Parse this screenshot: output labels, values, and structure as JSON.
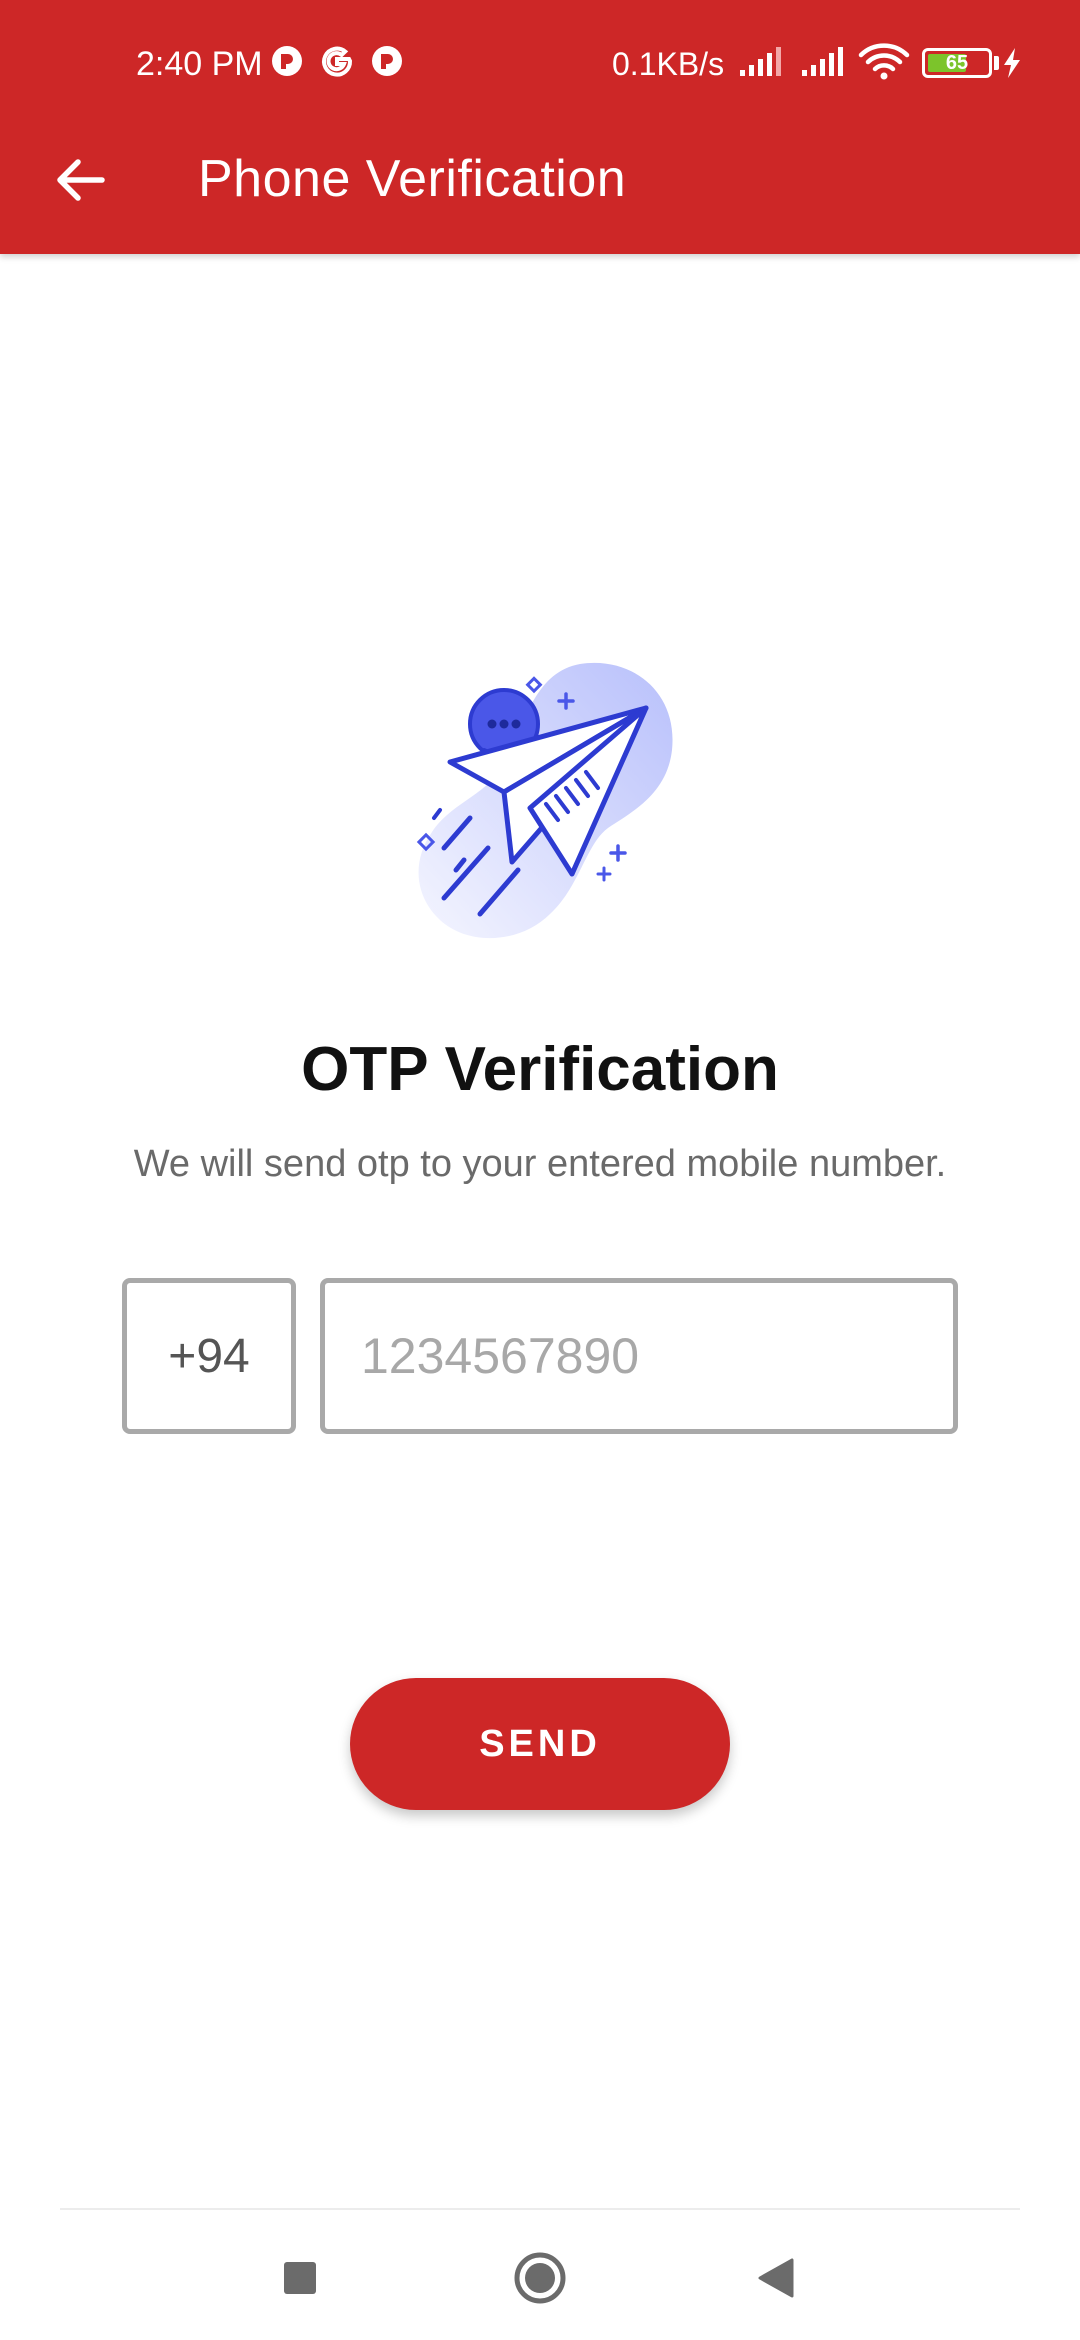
{
  "status_bar": {
    "time": "2:40 PM",
    "net_speed": "0.1KB/s",
    "battery_level": "65",
    "battery_fraction": 0.65,
    "notification_icons": [
      "record-icon",
      "google-icon",
      "record-icon"
    ],
    "icons": [
      "signal-icon",
      "signal-icon",
      "wifi-icon",
      "battery-icon",
      "charging-icon"
    ]
  },
  "toolbar": {
    "title": "Phone Verification",
    "back_icon": "arrow-left-icon"
  },
  "main": {
    "illustration": "paper-plane-chat-illustration",
    "headline": "OTP Verification",
    "subtitle": "We will send otp to your entered mobile number.",
    "country_code": "+94",
    "phone_placeholder": "1234567890",
    "phone_value": "",
    "send_label": "SEND"
  },
  "navbar": {
    "icons": [
      "recents-square-icon",
      "home-circle-icon",
      "back-triangle-icon"
    ]
  },
  "colors": {
    "primary": "#cd2727",
    "illustration_blue": "#2d3bd1",
    "illustration_light": "#c3c9fb",
    "input_border": "#a9a9a9"
  }
}
